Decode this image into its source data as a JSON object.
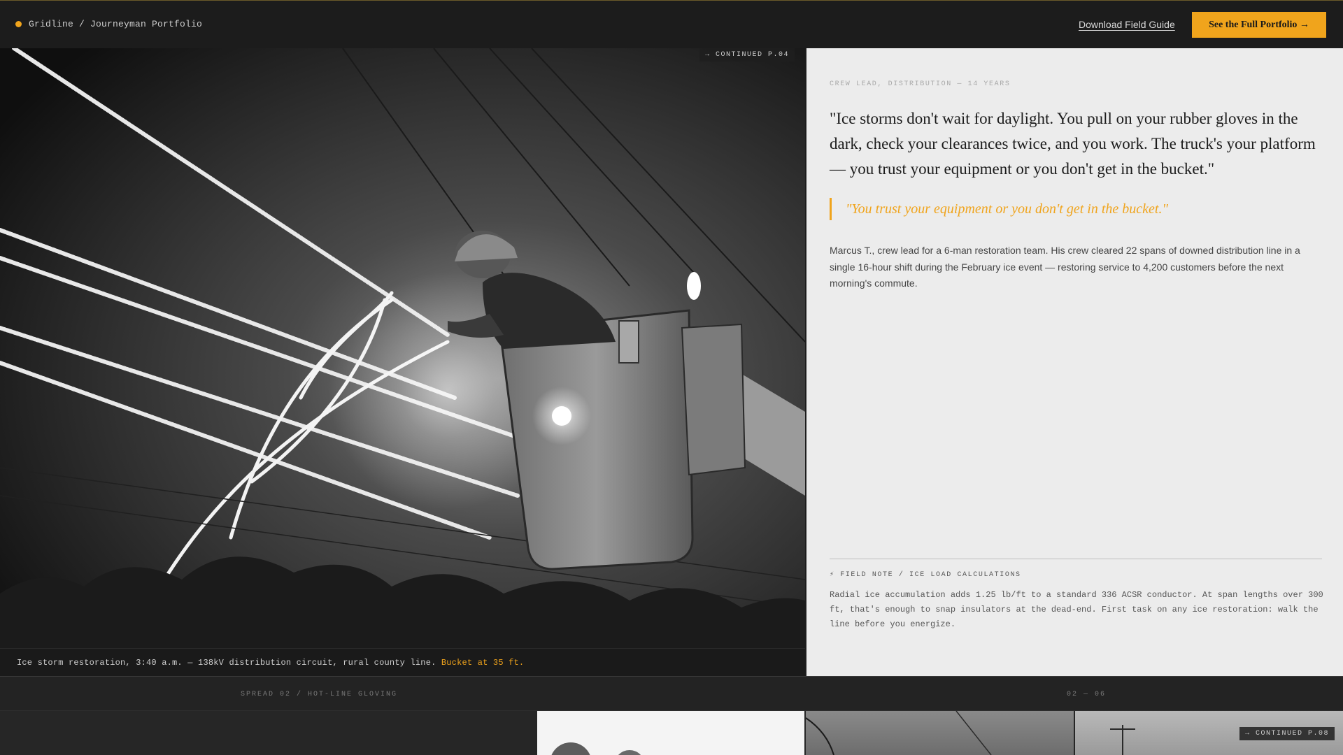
{
  "header": {
    "breadcrumb": "Gridline / Journeyman Portfolio",
    "download_link": "Download Field Guide",
    "cta_button": "See the Full Portfolio →",
    "brand_dot_color": "#f0a41c"
  },
  "hero": {
    "continued_tag": "→ CONTINUED P.04",
    "caption_main": "Ice storm restoration, 3:40 a.m. — 138kV distribution circuit, rural county line.",
    "caption_highlight": "Bucket at 35 ft."
  },
  "story": {
    "kicker": "CREW LEAD, DISTRIBUTION — 14 YEARS",
    "quote": "\"Ice storms don't wait for daylight. You pull on your rubber gloves in the dark, check your clearances twice, and you work. The truck's your platform — you trust your equipment or you don't get in the bucket.\"",
    "pull_quote": "\"You trust your equipment or you don't get in the bucket.\"",
    "body": "Marcus T., crew lead for a 6-man restoration team. His crew cleared 22 spans of downed distribution line in a single 16-hour shift during the February ice event — restoring service to 4,200 customers before the next morning's commute.",
    "field_note_title": "⚡ FIELD NOTE / ICE LOAD CALCULATIONS",
    "field_note_body": "Radial ice accumulation adds 1.25 lb/ft to a standard 336 ACSR conductor. At span lengths over 300 ft, that's enough to snap insulators at the dead-end. First task on any ice restoration: walk the line before you energize."
  },
  "spread": {
    "label": "SPREAD 02 / HOT-LINE GLOVING",
    "counter": "02 — 06",
    "thumb_tag": "→ CONTINUED P.08"
  },
  "colors": {
    "accent": "#f0a41c",
    "panel_bg": "#ececec",
    "chrome_bg": "#1c1c1c"
  }
}
